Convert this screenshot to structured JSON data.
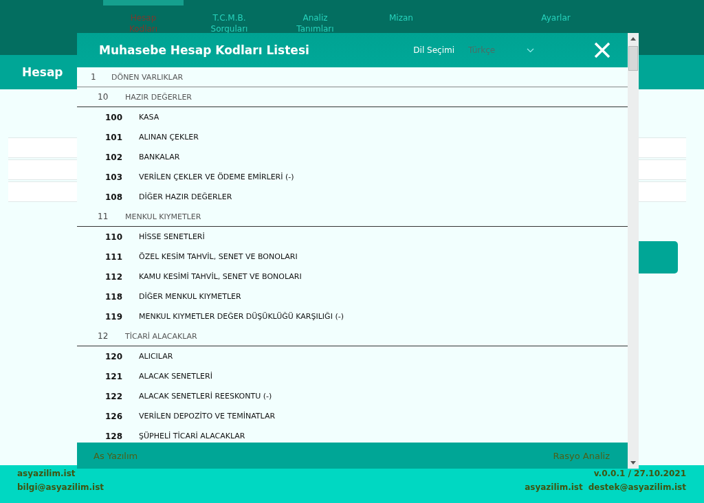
{
  "nav": {
    "tabs": [
      {
        "label": "Hesap\nKodları",
        "selected": true
      },
      {
        "label": "T.C.M.B.\nSorguları",
        "selected": false
      },
      {
        "label": "Analiz\nTanımları",
        "selected": false
      },
      {
        "label": "Mizan",
        "selected": false
      },
      {
        "label": "Ayarlar",
        "selected": false
      }
    ]
  },
  "page": {
    "title": "Hesap"
  },
  "dialog": {
    "title": "Muhasebe Hesap Kodları Listesi",
    "language_label": "Dil Seçimi",
    "language": "Türkçe",
    "accounts": [
      {
        "code": "1",
        "name": "DÖNEN VARLIKLAR",
        "children": [
          {
            "code": "10",
            "name": "HAZIR DEĞERLER",
            "children": [
              {
                "code": "100",
                "name": "KASA"
              },
              {
                "code": "101",
                "name": "ALINAN ÇEKLER"
              },
              {
                "code": "102",
                "name": "BANKALAR"
              },
              {
                "code": "103",
                "name": "VERİLEN ÇEKLER VE ÖDEME EMİRLERİ (-)"
              },
              {
                "code": "108",
                "name": "DİĞER HAZIR DEĞERLER"
              }
            ]
          },
          {
            "code": "11",
            "name": "MENKUL KIYMETLER",
            "children": [
              {
                "code": "110",
                "name": "HİSSE SENETLERİ"
              },
              {
                "code": "111",
                "name": "ÖZEL KESİM TAHVİL, SENET VE BONOLARI"
              },
              {
                "code": "112",
                "name": "KAMU KESİMİ TAHVİL, SENET VE BONOLARI"
              },
              {
                "code": "118",
                "name": "DİĞER MENKUL KIYMETLER"
              },
              {
                "code": "119",
                "name": "MENKUL KIYMETLER DEĞER DÜŞÜKLÜĞÜ KARŞILIĞI (-)"
              }
            ]
          },
          {
            "code": "12",
            "name": "TİCARİ ALACAKLAR",
            "children": [
              {
                "code": "120",
                "name": "ALICILAR"
              },
              {
                "code": "121",
                "name": "ALACAK SENETLERİ"
              },
              {
                "code": "122",
                "name": "ALACAK SENETLERİ REESKONTU (-)"
              },
              {
                "code": "126",
                "name": "VERİLEN DEPOZİTO VE TEMİNATLAR"
              },
              {
                "code": "128",
                "name": "ŞÜPHELİ TİCARİ ALACAKLAR"
              }
            ]
          }
        ]
      }
    ],
    "footer_left": "As Yazılım",
    "footer_right": "Rasyo Analiz"
  },
  "footer": {
    "left": [
      "asyazilim.ist",
      "bilgi@asyazilim.ist"
    ],
    "version": "v.0.0.1 / 27.10.2021",
    "links": [
      "asyazilim.ist",
      "destek@asyazilim.ist"
    ]
  }
}
